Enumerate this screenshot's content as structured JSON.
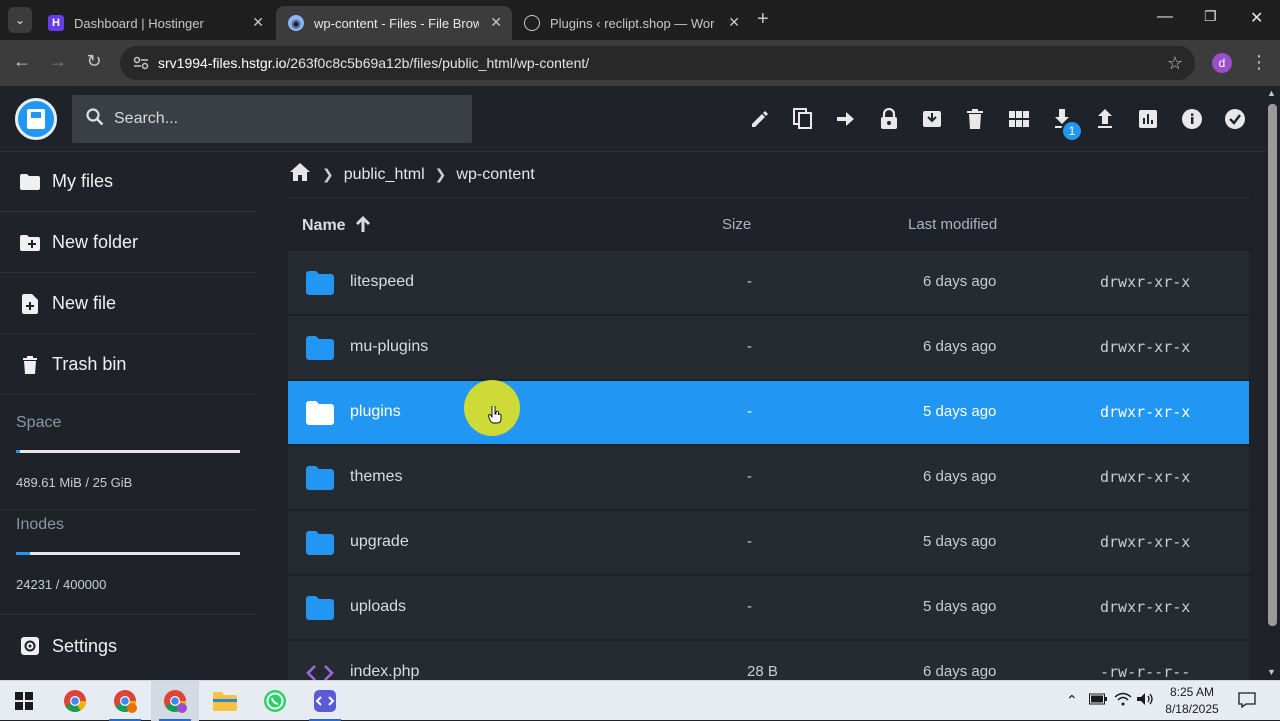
{
  "browser": {
    "tabs": [
      {
        "title": "Dashboard | Hostinger",
        "active": false
      },
      {
        "title": "wp-content - Files - File Browser",
        "active": true
      },
      {
        "title": "Plugins ‹ reclipt.shop — WordPress",
        "active": false
      }
    ],
    "url_host": "srv1994-files.hstgr.io",
    "url_path": "/263f0c8c5b69a12b/files/public_html/wp-content/",
    "profile_initial": "d"
  },
  "header": {
    "search_placeholder": "Search...",
    "download_badge": "1"
  },
  "sidebar": {
    "items": [
      {
        "label": "My files",
        "icon": "folder-icon"
      },
      {
        "label": "New folder",
        "icon": "folder-plus-icon"
      },
      {
        "label": "New file",
        "icon": "file-plus-icon"
      },
      {
        "label": "Trash bin",
        "icon": "trash-icon"
      }
    ],
    "space_label": "Space",
    "space_value": "489.61 MiB / 25 GiB",
    "space_fraction": 0.019,
    "inodes_label": "Inodes",
    "inodes_value": "24231 / 400000",
    "inodes_fraction": 0.061,
    "settings_label": "Settings"
  },
  "breadcrumb": [
    "public_html",
    "wp-content"
  ],
  "table": {
    "headers": {
      "name": "Name",
      "size": "Size",
      "modified": "Last modified"
    },
    "rows": [
      {
        "name": "litespeed",
        "size": "-",
        "modified": "6 days ago",
        "perm": "drwxr-xr-x",
        "type": "folder",
        "selected": false
      },
      {
        "name": "mu-plugins",
        "size": "-",
        "modified": "6 days ago",
        "perm": "drwxr-xr-x",
        "type": "folder",
        "selected": false
      },
      {
        "name": "plugins",
        "size": "-",
        "modified": "5 days ago",
        "perm": "drwxr-xr-x",
        "type": "folder",
        "selected": true
      },
      {
        "name": "themes",
        "size": "-",
        "modified": "6 days ago",
        "perm": "drwxr-xr-x",
        "type": "folder",
        "selected": false
      },
      {
        "name": "upgrade",
        "size": "-",
        "modified": "5 days ago",
        "perm": "drwxr-xr-x",
        "type": "folder",
        "selected": false
      },
      {
        "name": "uploads",
        "size": "-",
        "modified": "5 days ago",
        "perm": "drwxr-xr-x",
        "type": "folder",
        "selected": false
      },
      {
        "name": "index.php",
        "size": "28 B",
        "modified": "6 days ago",
        "perm": "-rw-r--r--",
        "type": "code",
        "selected": false
      }
    ]
  },
  "taskbar": {
    "time": "8:25 AM",
    "date": "8/18/2025"
  },
  "colors": {
    "accent": "#2196f3",
    "background": "#1f2329",
    "row": "#262b32",
    "code_icon": "#9c6ade"
  }
}
